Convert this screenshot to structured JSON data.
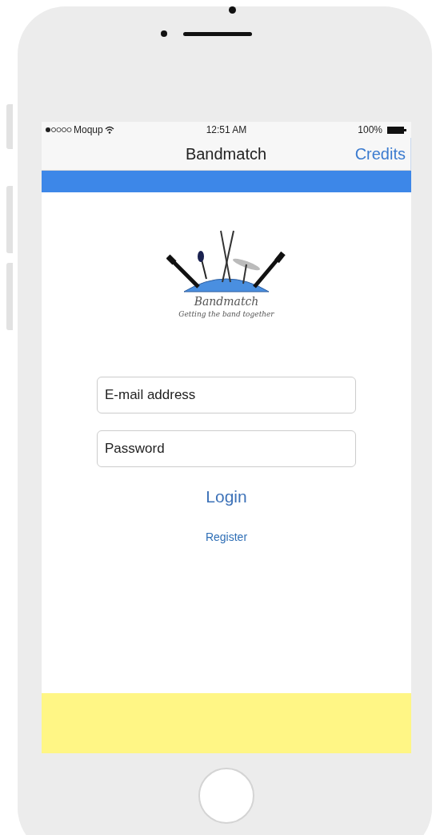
{
  "status_bar": {
    "carrier": "Moqup",
    "time": "12:51 AM",
    "battery": "100%"
  },
  "nav_bar": {
    "title": "Bandmatch",
    "action": "Credits"
  },
  "logo": {
    "name": "Bandmatch",
    "tagline": "Getting the band together"
  },
  "form": {
    "fields": [
      {
        "placeholder": "E-mail address"
      },
      {
        "placeholder": "Password"
      }
    ],
    "primary_action": "Login",
    "secondary_action": "Register"
  }
}
